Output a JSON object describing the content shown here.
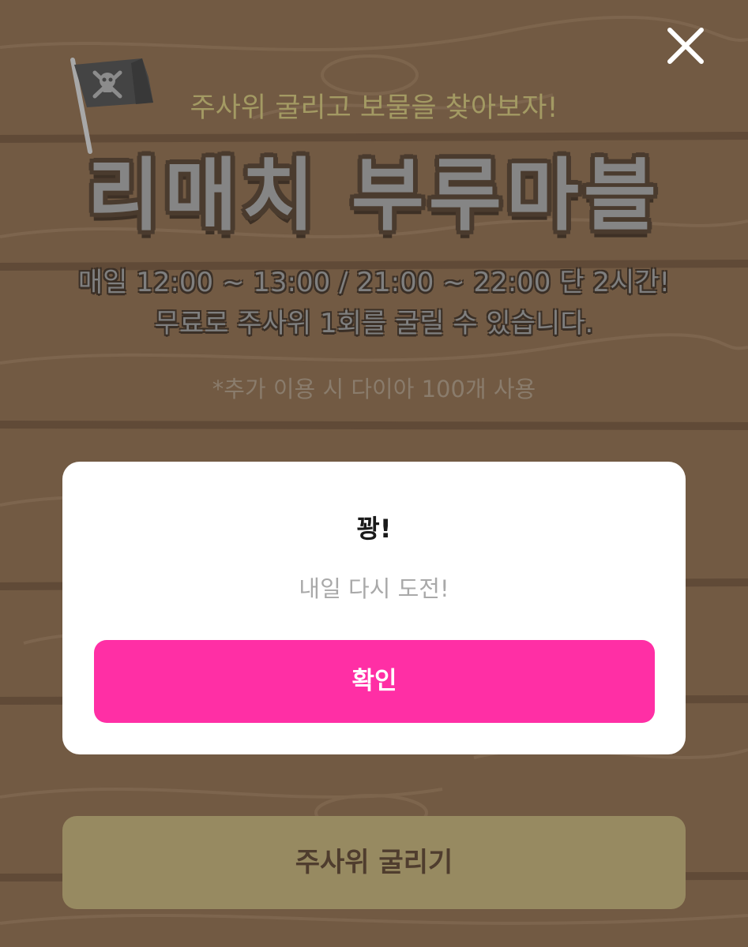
{
  "header": {
    "subtitle": "주사위 굴리고 보물을 찾아보자!",
    "title": "리매치 부루마블",
    "close_icon": "close-icon"
  },
  "info": {
    "line1": "매일 12:00 ~ 13:00 / 21:00 ~ 22:00 단 2시간!",
    "line2": "무료로 주사위 1회를 굴릴 수 있습니다.",
    "note": "*추가 이용 시 다이아 100개 사용"
  },
  "modal": {
    "title": "꽝!",
    "message": "내일 다시 도전!",
    "confirm_label": "확인"
  },
  "footer": {
    "roll_label": "주사위 굴리기"
  },
  "colors": {
    "background": "#725a43",
    "accent": "#ff2fa5",
    "roll_button": "#978a61",
    "subtitle": "#a39a63"
  }
}
